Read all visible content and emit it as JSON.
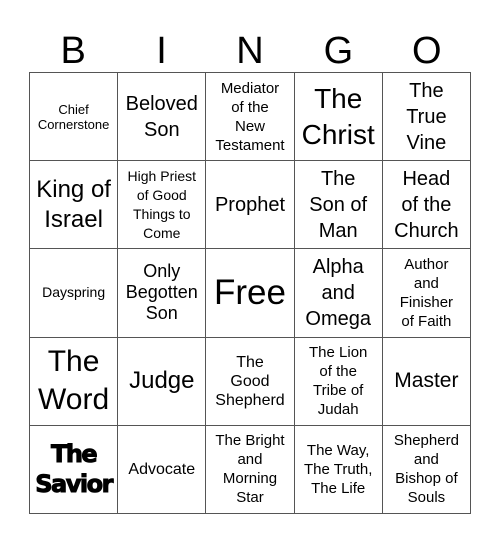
{
  "header": {
    "letters": [
      "B",
      "I",
      "N",
      "G",
      "O"
    ]
  },
  "board": {
    "rows": [
      [
        {
          "text": "Chief\nCornerstone",
          "size": "s13"
        },
        {
          "text": "Beloved\nSon",
          "size": "s20"
        },
        {
          "text": "Mediator\nof the\nNew\nTestament",
          "size": "s15"
        },
        {
          "text": "The\nChrist",
          "size": "s28"
        },
        {
          "text": "The\nTrue\nVine",
          "size": "s20"
        }
      ],
      [
        {
          "text": "King of\nIsrael",
          "size": "s24"
        },
        {
          "text": "High Priest\nof Good\nThings to\nCome",
          "size": "s14"
        },
        {
          "text": "Prophet",
          "size": "s20"
        },
        {
          "text": "The\nSon of\nMan",
          "size": "s20"
        },
        {
          "text": "Head\nof the\nChurch",
          "size": "s20"
        }
      ],
      [
        {
          "text": "Dayspring",
          "size": "s14"
        },
        {
          "text": "Only\nBegotten\nSon",
          "size": "s18"
        },
        {
          "text": "Free",
          "size": "s35"
        },
        {
          "text": "Alpha\nand\nOmega",
          "size": "s20"
        },
        {
          "text": "Author\nand\nFinisher\nof Faith",
          "size": "s15"
        }
      ],
      [
        {
          "text": "The\nWord",
          "size": "s30"
        },
        {
          "text": "Judge",
          "size": "s24"
        },
        {
          "text": "The\nGood\nShepherd",
          "size": "s16"
        },
        {
          "text": "The Lion\nof the\nTribe of\nJudah",
          "size": "s15"
        },
        {
          "text": "Master",
          "size": "s21"
        }
      ],
      [
        {
          "text": "The\nSavior",
          "size": "heavy"
        },
        {
          "text": "Advocate",
          "size": "s16"
        },
        {
          "text": "The Bright\nand\nMorning\nStar",
          "size": "s15"
        },
        {
          "text": "The Way,\nThe Truth,\nThe Life",
          "size": "s15"
        },
        {
          "text": "Shepherd\nand\nBishop of\nSouls",
          "size": "s15"
        }
      ]
    ]
  }
}
